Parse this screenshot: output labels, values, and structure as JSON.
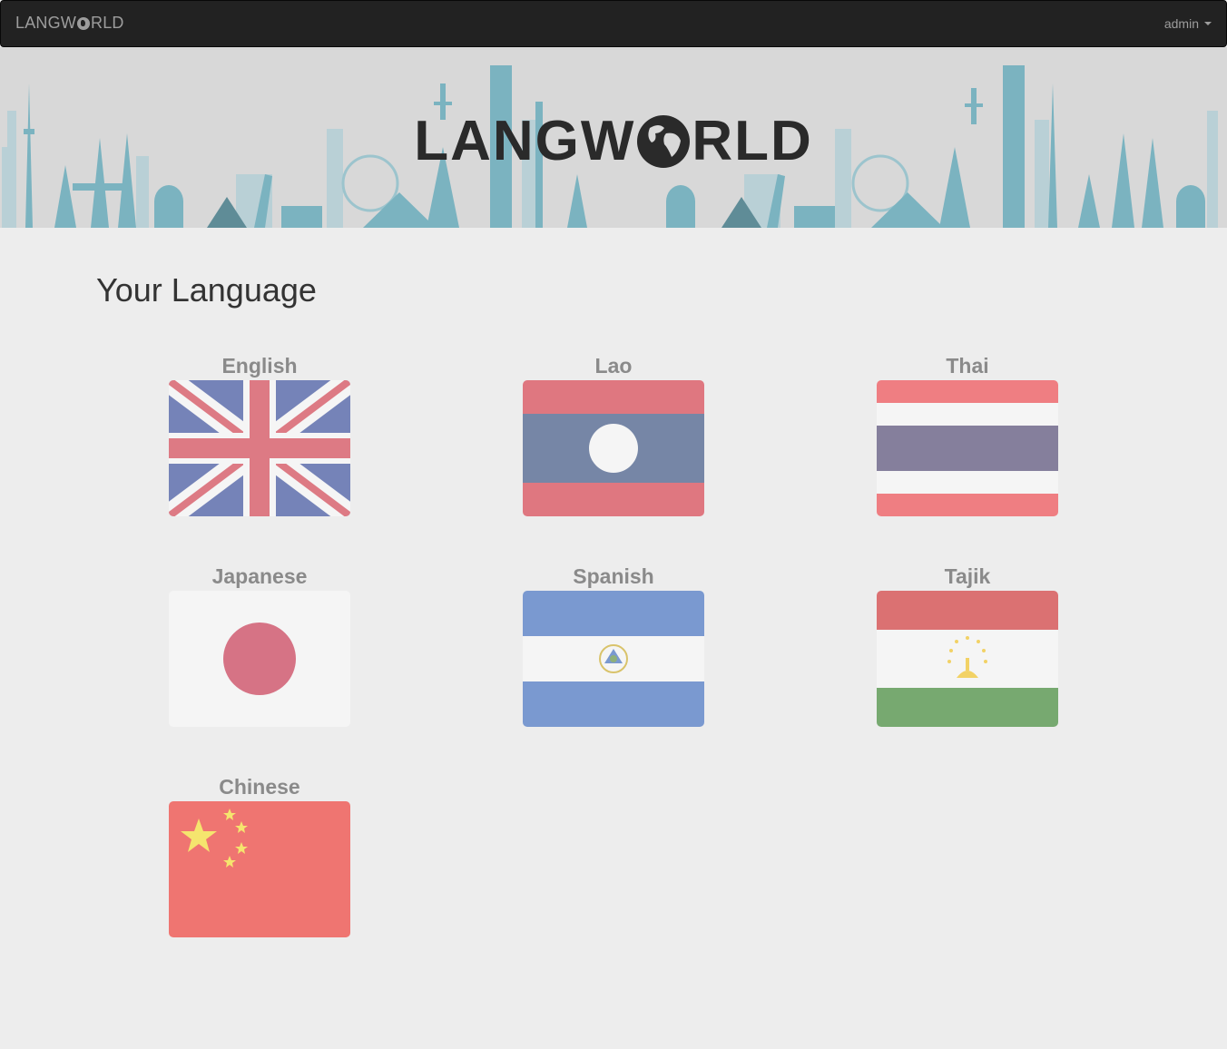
{
  "navbar": {
    "brand_left": "LANGW",
    "brand_right": "RLD",
    "user": "admin"
  },
  "banner": {
    "logo_left": "LANGW",
    "logo_right": "RLD"
  },
  "page": {
    "heading": "Your Language"
  },
  "languages": [
    {
      "name": "English",
      "flag": "uk-flag-icon"
    },
    {
      "name": "Lao",
      "flag": "laos-flag-icon"
    },
    {
      "name": "Thai",
      "flag": "thailand-flag-icon"
    },
    {
      "name": "Japanese",
      "flag": "japan-flag-icon"
    },
    {
      "name": "Spanish",
      "flag": "el-salvador-flag-icon"
    },
    {
      "name": "Tajik",
      "flag": "tajikistan-flag-icon"
    },
    {
      "name": "Chinese",
      "flag": "china-flag-icon"
    }
  ],
  "colors": {
    "navbar_bg": "#222222",
    "page_bg": "#ededed",
    "skyline": "#7bb3c0",
    "label_text": "#8a8a8a"
  }
}
